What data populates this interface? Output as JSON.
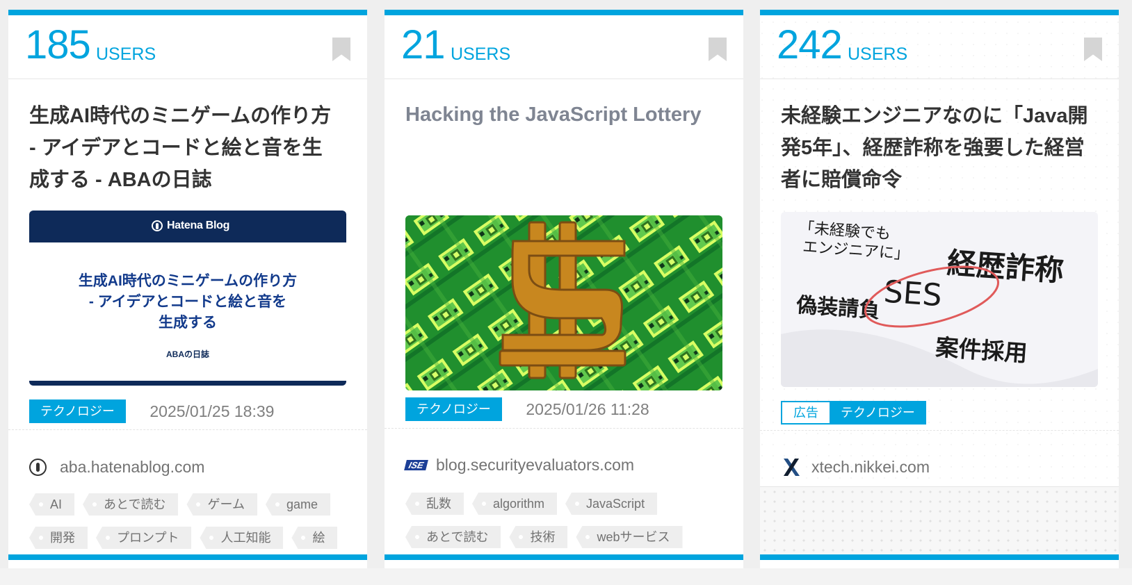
{
  "cards": [
    {
      "users_count": "185",
      "users_label": "USERS",
      "title": "生成AI時代のミニゲームの作り方 - アイデアとコードと絵と音を生成する - ABAの日誌",
      "thumbnail": {
        "logo_text": "Hatena Blog",
        "title": "生成AI時代のミニゲームの作り方\n- アイデアとコードと絵と音を\n生成する",
        "subtitle": "ABAの日誌"
      },
      "category": "テクノロジー",
      "date": "2025/01/25 18:39",
      "domain": "aba.hatenablog.com",
      "tags": [
        "AI",
        "あとで読む",
        "ゲーム",
        "game",
        "開発",
        "プロンプト",
        "人工知能",
        "絵"
      ]
    },
    {
      "users_count": "21",
      "users_label": "USERS",
      "title": "Hacking the JavaScript Lottery",
      "category": "テクノロジー",
      "date": "2025/01/26 11:28",
      "domain": "blog.securityevaluators.com",
      "source_icon_text": "ISE",
      "tags": [
        "乱数",
        "algorithm",
        "JavaScript",
        "あとで読む",
        "技術",
        "webサービス"
      ]
    },
    {
      "users_count": "242",
      "users_label": "USERS",
      "title": "未経験エンジニアなのに「Java開発5年」、経歴詐称を強要した経営者に賠償命令",
      "thumbnail": {
        "lines": [
          "「未経験でも",
          "エンジニアに」",
          "経歴詐称",
          "SES",
          "偽装請負",
          "案件採用"
        ]
      },
      "ad_label": "広告",
      "category": "テクノロジー",
      "domain": "xtech.nikkei.com"
    }
  ],
  "colors": {
    "accent": "#00a4de",
    "title": "#333333",
    "muted": "#737373",
    "tag_background": "#eeeeee"
  }
}
